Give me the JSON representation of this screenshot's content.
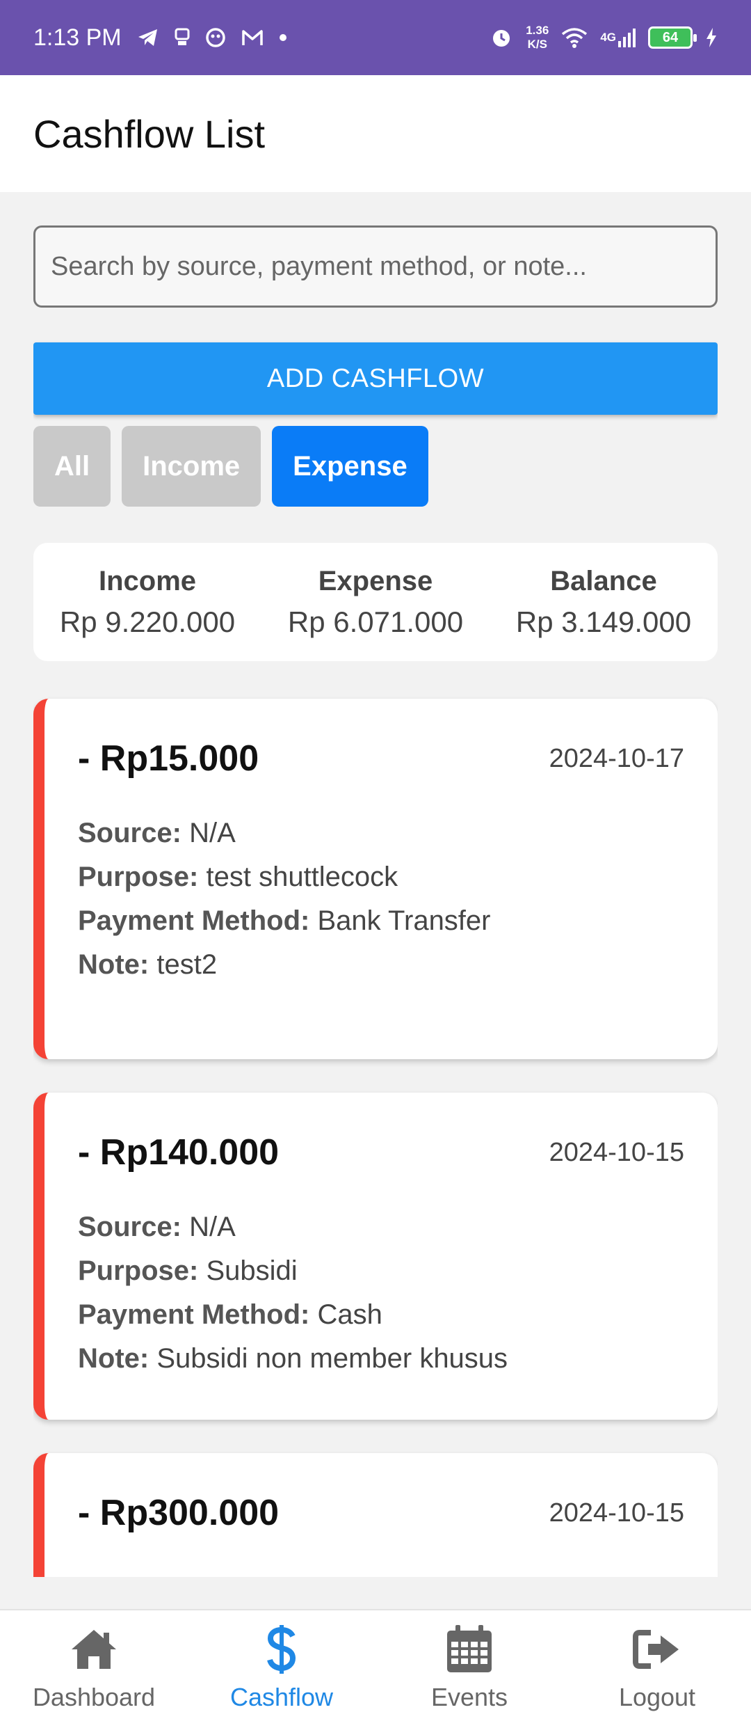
{
  "status_bar": {
    "time": "1:13 PM",
    "net_speed_value": "1.36",
    "net_speed_unit": "K/S",
    "network": "4G",
    "battery": "64"
  },
  "app_bar": {
    "title": "Cashflow List"
  },
  "search": {
    "placeholder": "Search by source, payment method, or note...",
    "value": ""
  },
  "add_button_label": "ADD CASHFLOW",
  "filters": [
    {
      "label": "All",
      "active": false
    },
    {
      "label": "Income",
      "active": false
    },
    {
      "label": "Expense",
      "active": true
    }
  ],
  "summary": {
    "income_label": "Income",
    "income_value": "Rp 9.220.000",
    "expense_label": "Expense",
    "expense_value": "Rp 6.071.000",
    "balance_label": "Balance",
    "balance_value": "Rp 3.149.000"
  },
  "field_labels": {
    "source": "Source:",
    "purpose": "Purpose:",
    "payment_method": "Payment Method:",
    "note": "Note:"
  },
  "cashflows": [
    {
      "amount": "- Rp15.000",
      "date": "2024-10-17",
      "source": "N/A",
      "purpose": "test shuttlecock",
      "payment_method": "Bank Transfer",
      "note": "test2"
    },
    {
      "amount": "- Rp140.000",
      "date": "2024-10-15",
      "source": "N/A",
      "purpose": "Subsidi",
      "payment_method": "Cash",
      "note": "Subsidi non member khusus"
    },
    {
      "amount": "- Rp300.000",
      "date": "2024-10-15"
    }
  ],
  "colors": {
    "accent": "#2196f3",
    "filter_active": "#0a7cf7",
    "expense_bar": "#f44336",
    "status_bar": "#6a52ad",
    "nav_active": "#1f88e5"
  },
  "bottom_nav": [
    {
      "label": "Dashboard",
      "icon": "home-icon",
      "active": false
    },
    {
      "label": "Cashflow",
      "icon": "dollar-icon",
      "active": true
    },
    {
      "label": "Events",
      "icon": "calendar-icon",
      "active": false
    },
    {
      "label": "Logout",
      "icon": "logout-icon",
      "active": false
    }
  ]
}
